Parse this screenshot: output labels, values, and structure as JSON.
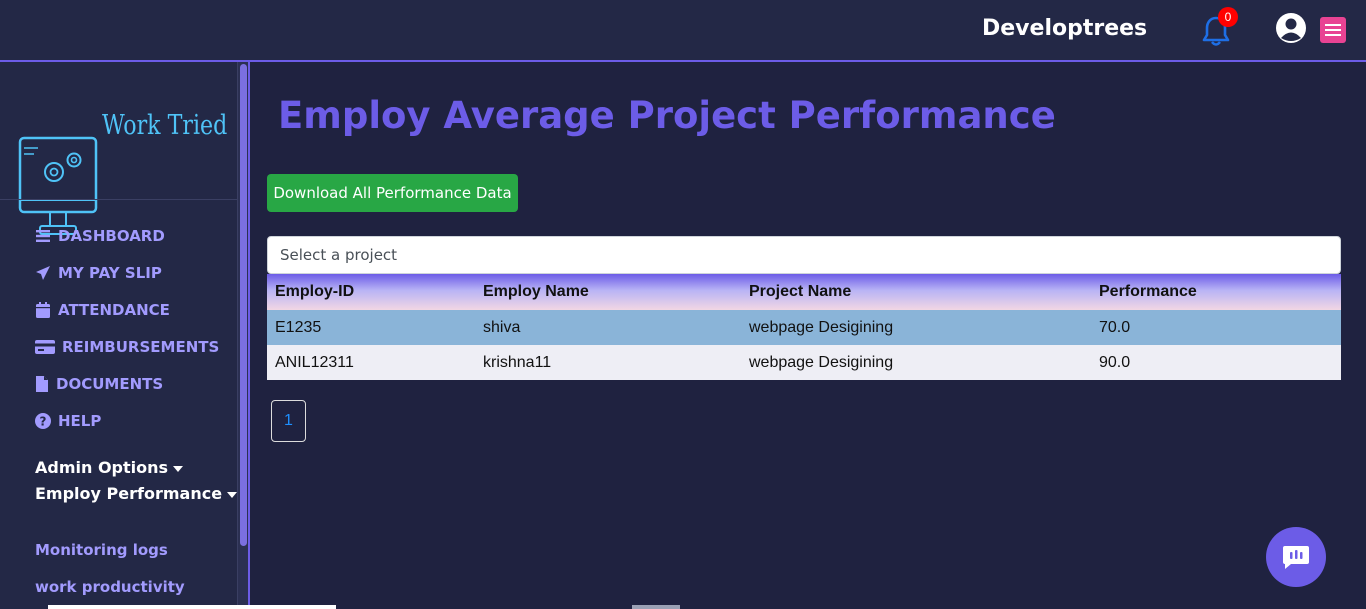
{
  "header": {
    "brand": "Developtrees",
    "notification_count": "0"
  },
  "logo": {
    "text": "Work Tried"
  },
  "sidebar": {
    "items": [
      {
        "label": "DASHBOARD",
        "icon": "bars-icon"
      },
      {
        "label": "MY PAY SLIP",
        "icon": "paper-plane-icon"
      },
      {
        "label": "ATTENDANCE",
        "icon": "calendar-icon"
      },
      {
        "label": "REIMBURSEMENTS",
        "icon": "credit-card-icon"
      },
      {
        "label": "DOCUMENTS",
        "icon": "file-icon"
      },
      {
        "label": "HELP",
        "icon": "question-circle-icon"
      }
    ],
    "admin_options": "Admin Options",
    "employ_performance": "Employ Performance",
    "sub_links": [
      "Monitoring logs",
      "work productivity"
    ]
  },
  "main": {
    "title": "Employ Average Project Performance",
    "download_label": "Download All Performance Data",
    "select_placeholder": "Select a project",
    "table": {
      "headers": [
        "Employ-ID",
        "Employ Name",
        "Project Name",
        "Performance"
      ],
      "rows": [
        [
          "E1235",
          "shiva",
          "webpage Desigining",
          "70.0"
        ],
        [
          "ANIL12311",
          "krishna11",
          "webpage Desigining",
          "90.0"
        ]
      ]
    },
    "pagination": {
      "current_page": "1"
    }
  },
  "colors": {
    "accent": "#6c5ce7",
    "download_button": "#28a745",
    "selected_row": "#8ab4d8",
    "menu_button": "#e84393"
  }
}
